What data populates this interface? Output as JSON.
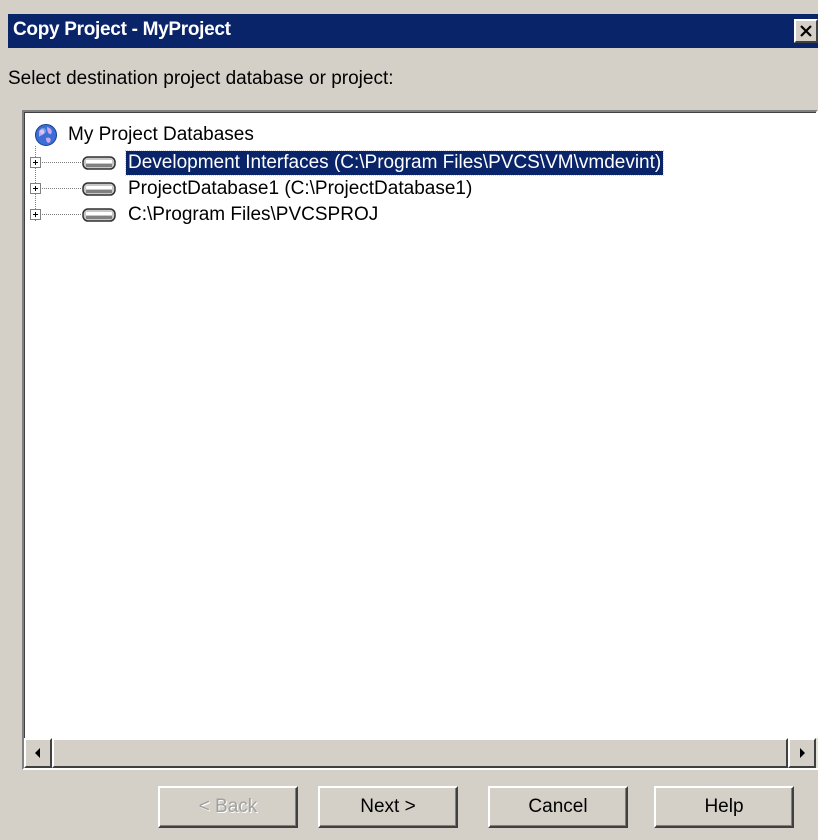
{
  "window": {
    "title": "Copy Project - MyProject",
    "close_icon": "close-icon",
    "titlebar_color": "#0a246a"
  },
  "instruction": "Select destination project database or project:",
  "tree": {
    "root": {
      "label": "My Project Databases",
      "icon": "globe-icon"
    },
    "nodes": [
      {
        "label": "Development Interfaces (C:\\Program Files\\PVCS\\VM\\vmdevint)",
        "icon": "database-icon",
        "selected": true
      },
      {
        "label": "ProjectDatabase1 (C:\\ProjectDatabase1)",
        "icon": "database-icon",
        "selected": false
      },
      {
        "label": "C:\\Program Files\\PVCSPROJ",
        "icon": "database-icon",
        "selected": false
      }
    ]
  },
  "buttons": {
    "back": "< Back",
    "next": "Next >",
    "cancel": "Cancel",
    "help": "Help"
  },
  "colors": {
    "selection": "#0a246a",
    "dialog_bg": "#d4d0c8"
  }
}
